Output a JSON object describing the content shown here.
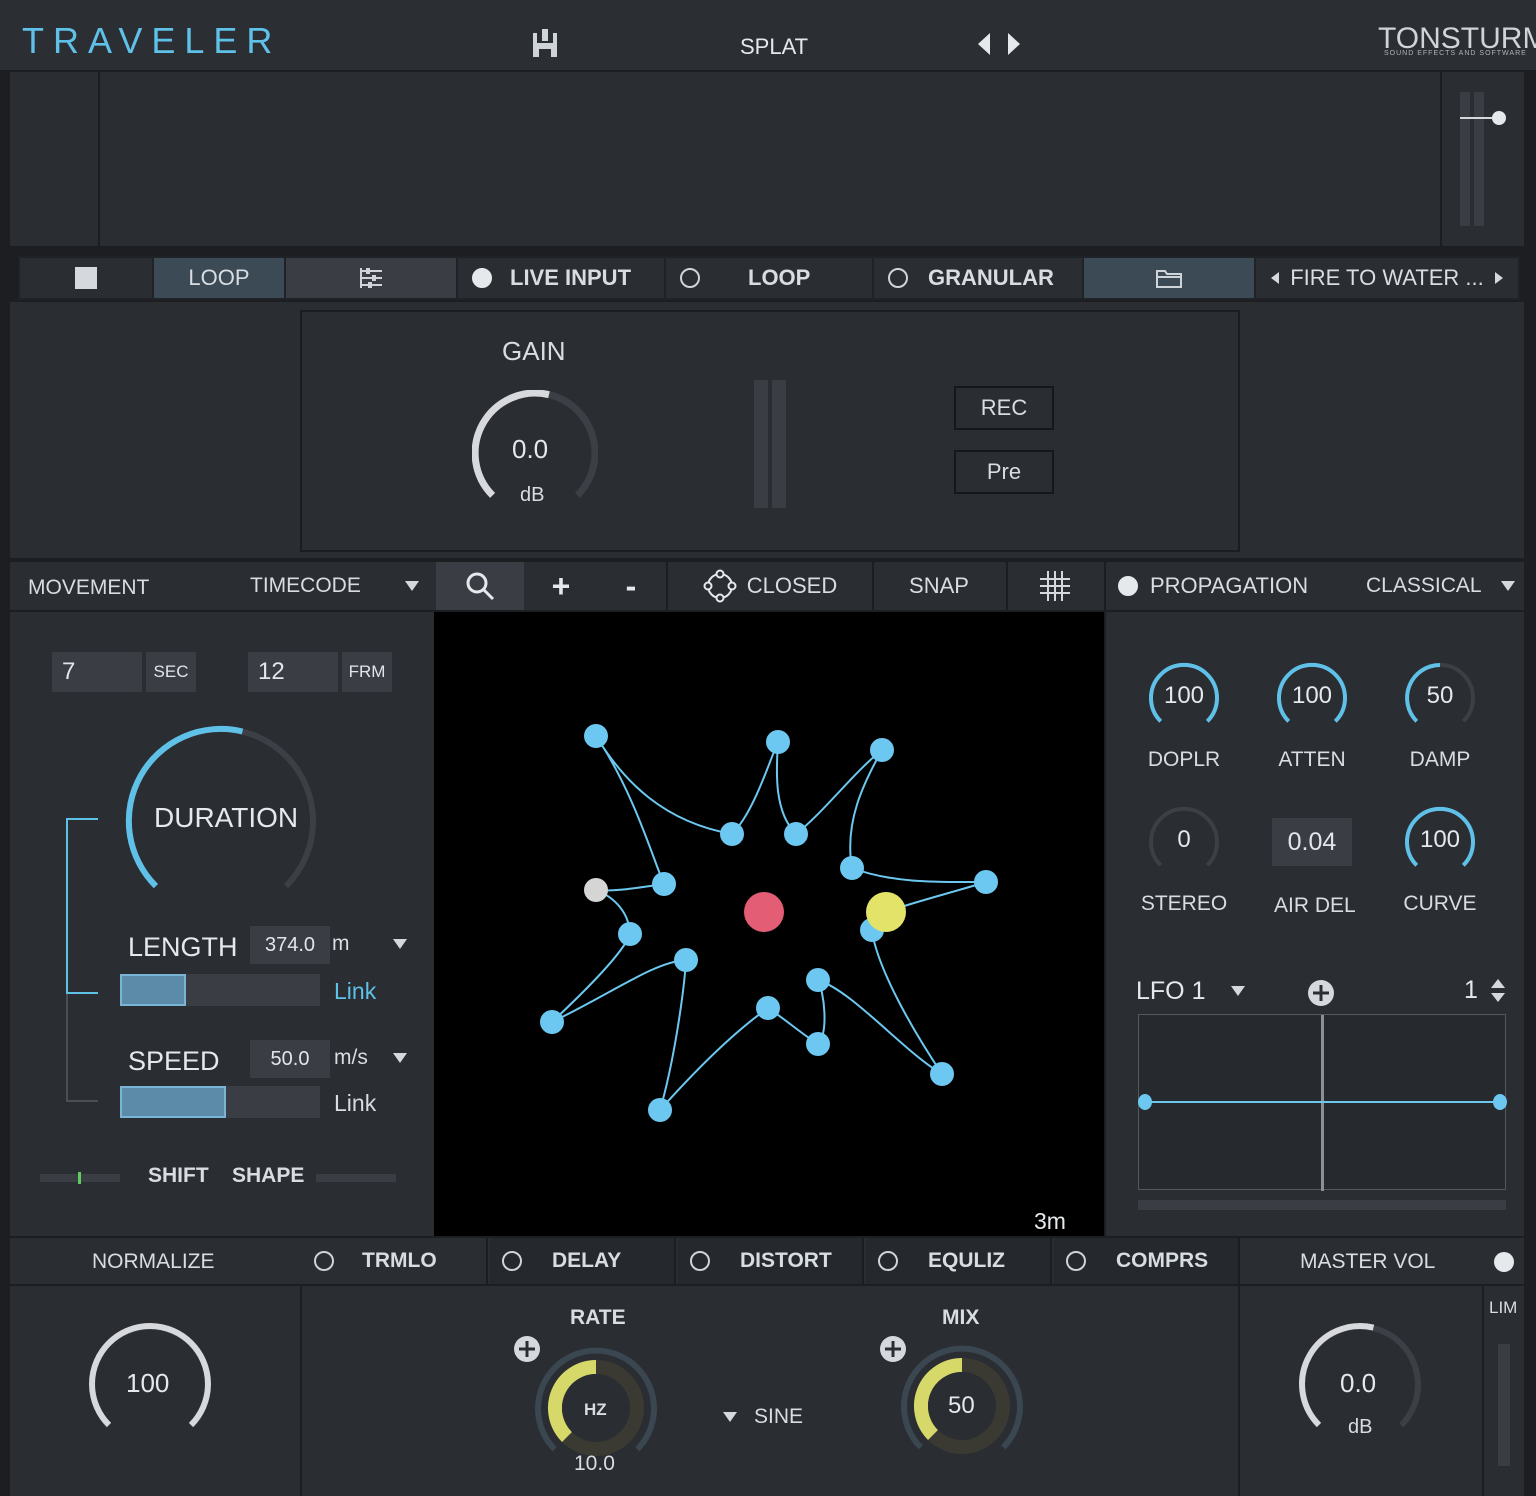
{
  "header": {
    "app_title": "TRAVELER",
    "preset_name": "SPLAT",
    "brand": "TONSTURM",
    "brand_tagline": "SOUND EFFECTS AND SOFTWARE"
  },
  "source_bar": {
    "loop_label": "LOOP",
    "live_input_label": "LIVE INPUT",
    "loop2_label": "LOOP",
    "granular_label": "GRANULAR",
    "file_name": "FIRE TO WATER ..."
  },
  "input_panel": {
    "gain_label": "GAIN",
    "gain_value": "0.0",
    "gain_unit": "dB",
    "rec_label": "REC",
    "pre_label": "Pre"
  },
  "movement_bar": {
    "movement_label": "MOVEMENT",
    "timecode_label": "TIMECODE",
    "plus_label": "+",
    "minus_label": "-",
    "closed_label": "CLOSED",
    "snap_label": "SNAP",
    "propagation_label": "PROPAGATION",
    "mode_label": "CLASSICAL"
  },
  "movement": {
    "sec_value": "7",
    "sec_unit": "SEC",
    "frm_value": "12",
    "frm_unit": "FRM",
    "duration_label": "DURATION",
    "duration_level": 0.55,
    "length_label": "LENGTH",
    "length_value": "374.0",
    "length_unit": "m",
    "length_link": "Link",
    "length_level": 0.33,
    "speed_label": "SPEED",
    "speed_value": "50.0",
    "speed_unit": "m/s",
    "speed_link": "Link",
    "speed_level": 0.53,
    "shift_label": "SHIFT",
    "shape_label": "SHAPE"
  },
  "path_view": {
    "scale_label": "3m"
  },
  "propagation": {
    "knobs": [
      {
        "value": "100",
        "label": "DOPLR",
        "level": 1.0
      },
      {
        "value": "100",
        "label": "ATTEN",
        "level": 1.0
      },
      {
        "value": "50",
        "label": "DAMP",
        "level": 0.5
      },
      {
        "value": "0",
        "label": "STEREO",
        "level": 0.0
      },
      {
        "value": "100",
        "label": "CURVE",
        "level": 1.0
      }
    ],
    "air_del_value": "0.04",
    "air_del_label": "AIR DEL",
    "lfo_label": "LFO 1",
    "lfo_count": "1"
  },
  "effects_bar": {
    "normalize_label": "NORMALIZE",
    "tabs": [
      "TRMLO",
      "DELAY",
      "DISTORT",
      "EQULIZ",
      "COMPRS"
    ],
    "master_label": "MASTER VOL"
  },
  "bottom": {
    "normalize_value": "100",
    "normalize_level": 1.0,
    "rate_label": "RATE",
    "rate_inner": "HZ",
    "rate_value": "10.0",
    "rate_level": 0.5,
    "wave_label": "SINE",
    "mix_label": "MIX",
    "mix_value": "50",
    "mix_level": 0.5,
    "master_value": "0.0",
    "master_unit": "dB",
    "master_level": 0.55,
    "lim_label": "LIM"
  },
  "colors": {
    "accent_blue": "#5fc1e8",
    "node_blue": "#6cc8f0",
    "listener_red": "#e35d75",
    "source_yellow": "#e3e36a",
    "node_grey": "#d5d5d5",
    "knob_yellow": "#d7d86a"
  }
}
